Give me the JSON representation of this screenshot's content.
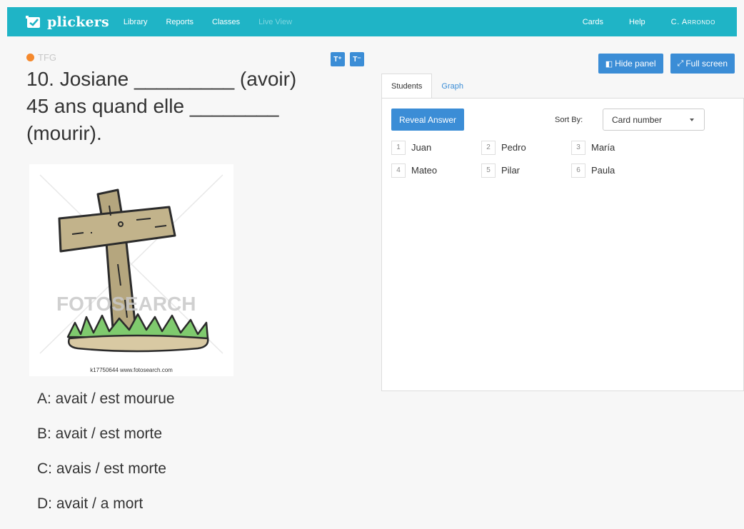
{
  "nav": {
    "brand": "plickers",
    "links": [
      "Library",
      "Reports",
      "Classes",
      "Live View"
    ],
    "right": {
      "cards": "Cards",
      "help": "Help",
      "user": "C. Arrondo"
    }
  },
  "question": {
    "tag": "TFG",
    "text_line1": "10. Josiane _________ (avoir)",
    "text_line2": "45 ans quand elle ________",
    "text_line3": "(mourir).",
    "image_caption": "k17750644  www.fotosearch.com",
    "image_watermark": "FOTOSEARCH",
    "font_buttons": [
      "T⁺",
      "T⁻"
    ],
    "answers": [
      "A: avait / est mourue",
      "B: avait / est morte",
      "C: avais / est morte",
      "D: avait / a mort"
    ]
  },
  "panel": {
    "hide_label": "Hide panel",
    "fullscreen_label": "Full screen",
    "tabs": [
      "Students",
      "Graph"
    ],
    "reveal_label": "Reveal Answer",
    "sort_label": "Sort By:",
    "sort_value": "Card number",
    "students": [
      {
        "num": "1",
        "name": "Juan"
      },
      {
        "num": "2",
        "name": "Pedro"
      },
      {
        "num": "3",
        "name": "María"
      },
      {
        "num": "4",
        "name": "Mateo"
      },
      {
        "num": "5",
        "name": "Pilar"
      },
      {
        "num": "6",
        "name": "Paula"
      }
    ]
  },
  "colors": {
    "nav": "#1fb4c6",
    "primary": "#3b8dd6",
    "tag_dot": "#f5892d"
  },
  "icons": [
    "plickers-logo-icon",
    "hide-panel-icon",
    "fullscreen-icon",
    "chevron-down-icon"
  ]
}
